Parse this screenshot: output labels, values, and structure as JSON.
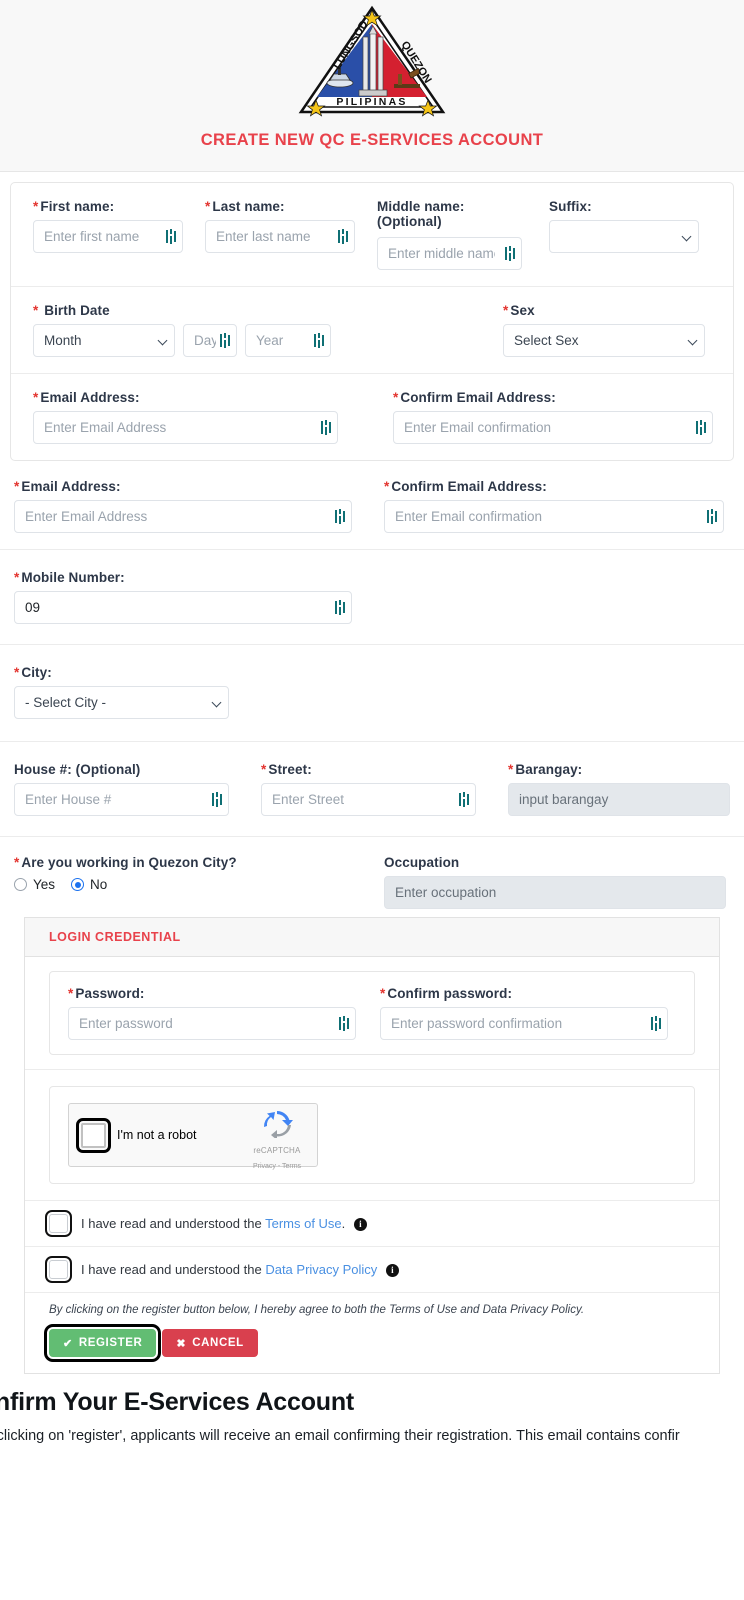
{
  "header": {
    "title": "CREATE NEW QC E-SERVICES ACCOUNT",
    "logo_alt": "Lungsod Quezon Pilipinas seal",
    "logo_text_top_left": "LUNGSOD",
    "logo_text_top_right": "QUEZON",
    "logo_text_bottom": "PILIPINAS",
    "title_color": "#e8424b"
  },
  "name_row": {
    "first_name_label": "First name:",
    "first_name_placeholder": "Enter first name",
    "first_name_value": "",
    "last_name_label": "Last name:",
    "last_name_placeholder": "Enter last name",
    "last_name_value": "",
    "middle_name_label": "Middle name:",
    "middle_name_label2": "(Optional)",
    "middle_name_placeholder": "Enter middle name",
    "middle_name_value": "",
    "suffix_label": "Suffix:",
    "suffix_value": ""
  },
  "birth_row": {
    "birth_date_label": "Birth Date",
    "month_value": "Month",
    "day_placeholder": "Day",
    "day_value": "",
    "year_placeholder": "Year",
    "year_value": "",
    "sex_label": "Sex",
    "sex_value": "Select Sex"
  },
  "email_row_1": {
    "email_label": "Email Address:",
    "email_placeholder": "Enter Email Address",
    "email_value": "",
    "confirm_label": "Confirm Email Address:",
    "confirm_placeholder": "Enter Email confirmation",
    "confirm_value": ""
  },
  "email_row_2": {
    "email_label": "Email Address:",
    "email_placeholder": "Enter Email Address",
    "email_value": "",
    "confirm_label": "Confirm Email Address:",
    "confirm_placeholder": "Enter Email confirmation",
    "confirm_value": ""
  },
  "mobile_row": {
    "label": "Mobile Number:",
    "value": "09"
  },
  "city_row": {
    "label": "City:",
    "value": "- Select City -"
  },
  "address_row": {
    "house_label": "House #: (Optional)",
    "house_placeholder": "Enter House #",
    "house_value": "",
    "street_label": "Street:",
    "street_placeholder": "Enter Street",
    "street_value": "",
    "barangay_label": "Barangay:",
    "barangay_placeholder": "input barangay",
    "barangay_value": "",
    "barangay_disabled": true
  },
  "work_row": {
    "question_label": "Are you working in Quezon City?",
    "yes_label": "Yes",
    "no_label": "No",
    "selected": "No",
    "occupation_label": "Occupation",
    "occupation_placeholder": "Enter occupation",
    "occupation_value": "",
    "occupation_disabled": true
  },
  "credential": {
    "section_title": "LOGIN CREDENTIAL",
    "password_label": "Password:",
    "password_placeholder": "Enter password",
    "password_value": "",
    "confirm_password_label": "Confirm password:",
    "confirm_password_placeholder": "Enter password confirmation",
    "confirm_password_value": ""
  },
  "recaptcha": {
    "checkbox_label": "I'm not a robot",
    "brand": "reCAPTCHA",
    "links": "Privacy - Terms",
    "checked": false,
    "focused": true
  },
  "agreements": [
    {
      "prefix": "I have read and understood the",
      "link": "Terms of Use",
      "suffix": ".",
      "info_icon": "info-icon",
      "checked": false,
      "focused": true
    },
    {
      "prefix": "I have read and understood the",
      "link": "Data Privacy Policy",
      "suffix": "",
      "info_icon": "info-icon",
      "checked": false,
      "focused": true
    }
  ],
  "footer": {
    "note": "By clicking on the register button below, I hereby agree to both the Terms of Use and Data Privacy Policy.",
    "register_label": "REGISTER",
    "register_icon": "check-icon",
    "register_color": "#62bd73",
    "cancel_label": "CANCEL",
    "cancel_icon": "close-icon",
    "cancel_color": "#d9404e"
  },
  "bottom": {
    "heading": "Confirm Your E-Services Account",
    "paragraph": "After clicking on 'register', applicants will receive an email confirming their registration. This email contains confir"
  }
}
